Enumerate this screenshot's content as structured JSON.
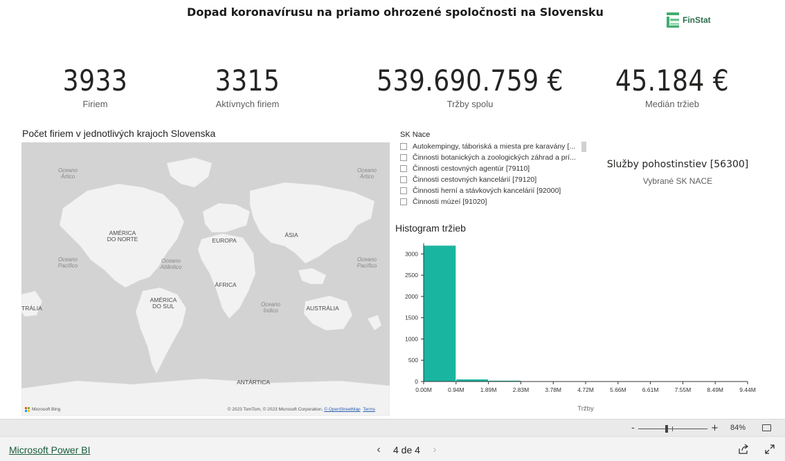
{
  "report": {
    "title": "Dopad koronavírusu na priamo ohrozené spoločnosti na Slovensku",
    "logo_text": "FinStat"
  },
  "kpis": [
    {
      "value": "3933",
      "label": "Firiem"
    },
    {
      "value": "3315",
      "label": "Aktívnych firiem"
    },
    {
      "value": "539.690.759 €",
      "label": "Tržby spolu"
    },
    {
      "value": "45.184 €",
      "label": "Medián tržieb"
    }
  ],
  "map": {
    "title": "Počet firiem v jednotlivých krajoch Slovenska",
    "labels": {
      "ocean_arctic_left": "Oceano\nÁrtico",
      "ocean_arctic_right": "Oceano\nÁrtico",
      "america_north": "AMÉRICA\nDO NORTE",
      "europe": "EUROPA",
      "asia": "ÁSIA",
      "ocean_pacific_left": "Oceano\nPacífico",
      "ocean_atlantic": "Oceano\nAtlântico",
      "ocean_pacific_right": "Oceano\nPacífico",
      "africa": "ÁFRICA",
      "australia_left": "TRÁLIA",
      "america_south": "AMÉRICA\nDO SUL",
      "ocean_indian": "Oceano\nÍndico",
      "australia": "AUSTRÁLIA",
      "antarctica": "ANTÁRTICA"
    },
    "attribution_brand": "Microsoft Bing",
    "copyright_text": "© 2023 TomTom, © 2023 Microsoft Corporation, ",
    "osm_link": "© OpenStreetMap",
    "terms_link": "Terms"
  },
  "slicer": {
    "title": "SK Nace",
    "items": [
      "Autokempingy, táboriská a miesta pre karavány [...",
      "Činnosti botanických a zoologických záhrad a prí...",
      "Činnosti cestovných agentúr [79110]",
      "Činnosti cestovných kancelárií [79120]",
      "Činnosti herní a stávkových kancelárií [92000]",
      "Činnosti múzeí [91020]"
    ]
  },
  "selected_card": {
    "value": "Služby pohostinstiev [56300]",
    "label": "Vybrané SK NACE"
  },
  "chart_data": {
    "type": "bar",
    "title": "Histogram tržieb",
    "xlabel": "Tržby",
    "ylabel": "",
    "x_tick_labels": [
      "0.00M",
      "0.94M",
      "1.89M",
      "2.83M",
      "3.78M",
      "4.72M",
      "5.66M",
      "6.61M",
      "7.55M",
      "8.49M",
      "9.44M"
    ],
    "y_ticks": [
      0,
      500,
      1000,
      1500,
      2000,
      2500,
      3000
    ],
    "ylim": [
      0,
      3250
    ],
    "bin_edges_m": [
      0.0,
      0.94,
      1.89,
      2.83,
      3.78,
      4.72,
      5.66,
      6.61,
      7.55,
      8.49,
      9.44
    ],
    "values": [
      3195,
      50,
      20,
      6,
      3,
      2,
      1,
      1,
      1,
      0
    ],
    "color": "#1ab5a1",
    "grid": false
  },
  "status": {
    "zoom_minus": "-",
    "zoom_plus": "+",
    "zoom_percent": "84%"
  },
  "footer": {
    "brand_link": "Microsoft Power BI",
    "page_indicator": "4 de 4",
    "prev": "‹",
    "next": "›"
  },
  "colors": {
    "accent": "#1ab5a1",
    "map_land": "#f2f2f2",
    "map_water": "#d3d3d3",
    "link": "#1a5b3c"
  }
}
